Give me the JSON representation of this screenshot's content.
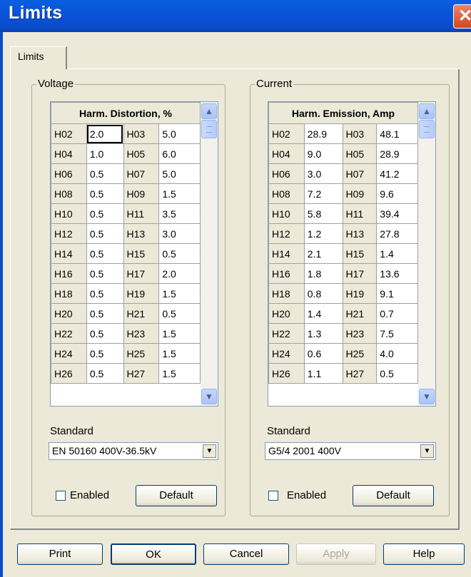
{
  "window": {
    "title": "Limits",
    "close_glyph": "✕"
  },
  "tabs": [
    {
      "label": "Limits",
      "selected": true
    }
  ],
  "voltage": {
    "group_label": "Voltage",
    "grid_header": "Harm. Distortion, %",
    "rows": [
      [
        "H02",
        "2.0",
        "H03",
        "5.0"
      ],
      [
        "H04",
        "1.0",
        "H05",
        "6.0"
      ],
      [
        "H06",
        "0.5",
        "H07",
        "5.0"
      ],
      [
        "H08",
        "0.5",
        "H09",
        "1.5"
      ],
      [
        "H10",
        "0.5",
        "H11",
        "3.5"
      ],
      [
        "H12",
        "0.5",
        "H13",
        "3.0"
      ],
      [
        "H14",
        "0.5",
        "H15",
        "0.5"
      ],
      [
        "H16",
        "0.5",
        "H17",
        "2.0"
      ],
      [
        "H18",
        "0.5",
        "H19",
        "1.5"
      ],
      [
        "H20",
        "0.5",
        "H21",
        "0.5"
      ],
      [
        "H22",
        "0.5",
        "H23",
        "1.5"
      ],
      [
        "H24",
        "0.5",
        "H25",
        "1.5"
      ],
      [
        "H26",
        "0.5",
        "H27",
        "1.5"
      ]
    ],
    "standard_label": "Standard",
    "standard_value": "EN 50160 400V-36.5kV",
    "enabled_label": "Enabled",
    "enabled": false,
    "default_label": "Default"
  },
  "current": {
    "group_label": "Current",
    "grid_header": "Harm. Emission, Amp",
    "rows": [
      [
        "H02",
        "28.9",
        "H03",
        "48.1"
      ],
      [
        "H04",
        "9.0",
        "H05",
        "28.9"
      ],
      [
        "H06",
        "3.0",
        "H07",
        "41.2"
      ],
      [
        "H08",
        "7.2",
        "H09",
        "9.6"
      ],
      [
        "H10",
        "5.8",
        "H11",
        "39.4"
      ],
      [
        "H12",
        "1.2",
        "H13",
        "27.8"
      ],
      [
        "H14",
        "2.1",
        "H15",
        "1.4"
      ],
      [
        "H16",
        "1.8",
        "H17",
        "13.6"
      ],
      [
        "H18",
        "0.8",
        "H19",
        "9.1"
      ],
      [
        "H20",
        "1.4",
        "H21",
        "0.7"
      ],
      [
        "H22",
        "1.3",
        "H23",
        "7.5"
      ],
      [
        "H24",
        "0.6",
        "H25",
        "4.0"
      ],
      [
        "H26",
        "1.1",
        "H27",
        "0.5"
      ]
    ],
    "standard_label": "Standard",
    "standard_value": "G5/4 2001 400V",
    "enabled_label": "Enabled",
    "enabled": false,
    "default_label": "Default"
  },
  "buttons": {
    "print": "Print",
    "ok": "OK",
    "cancel": "Cancel",
    "apply": "Apply",
    "help": "Help"
  },
  "icons": {
    "scroll_up": "▲",
    "scroll_down": "▼",
    "dropdown": "▼"
  }
}
